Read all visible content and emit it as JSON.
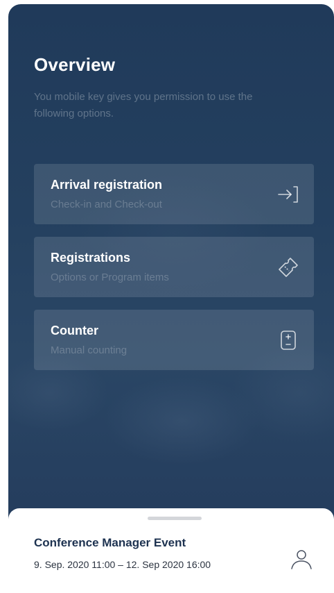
{
  "overview": {
    "title": "Overview",
    "subtitle": "You mobile key gives you permission to use the following options."
  },
  "options": [
    {
      "title": "Arrival registration",
      "subtitle": "Check-in and Check-out",
      "icon": "login-arrow-icon"
    },
    {
      "title": "Registrations",
      "subtitle": "Options or Program items",
      "icon": "ticket-icon"
    },
    {
      "title": "Counter",
      "subtitle": "Manual counting",
      "icon": "counter-plus-minus-icon"
    }
  ],
  "event": {
    "name": "Conference Manager Event",
    "dates": "9. Sep. 2020 11:00  –  12. Sep 2020 16:00"
  },
  "colors": {
    "background": "#22395a",
    "card": "rgba(255,255,255,0.12)",
    "event_text": "#1d3250"
  }
}
